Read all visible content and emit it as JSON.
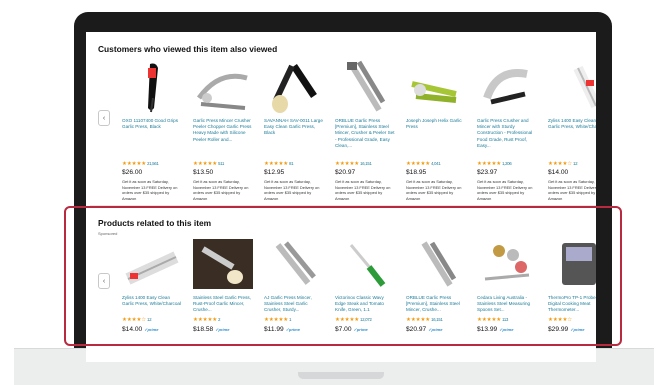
{
  "section1": {
    "title": "Customers who viewed this item also viewed",
    "items": [
      {
        "title": "OXO 11107400 Good Grips Garlic Press, Black",
        "stars": "★★★★★",
        "reviews": "21,561",
        "price": "$26.00",
        "meta": "Get it as soon as Saturday, November 13 FREE Delivery on orders over $35 shipped by Amazon"
      },
      {
        "title": "Garlic Press Mincer Crusher Peeler Chopper Garlic Press Heavy Made with Silicone Peeler Roller and...",
        "stars": "★★★★★",
        "reviews": "511",
        "price": "$13.50",
        "meta": "Get it as soon as Saturday, November 13 FREE Delivery on orders over $35 shipped by Amazon"
      },
      {
        "title": "SAVANNAH SAV-0011 Large Easy Clean Garlic Press, Black",
        "stars": "★★★★★",
        "reviews": "81",
        "price": "$12.95",
        "meta": "Get it as soon as Saturday, November 13 FREE Delivery on orders over $35 shipped by Amazon"
      },
      {
        "title": "ORBLUE Garlic Press [Premium], Stainless Steel Mincer, Crusher & Peeler Set - Professional Grade, Easy Clean,...",
        "stars": "★★★★★",
        "reviews": "16,151",
        "price": "$20.97",
        "meta": "Get it as soon as Saturday, November 13 FREE Delivery on orders over $35 shipped by Amazon"
      },
      {
        "title": "Joseph Joseph Helix Garlic Press",
        "stars": "★★★★★",
        "reviews": "4,041",
        "price": "$18.95",
        "meta": "Get it as soon as Saturday, November 13 FREE Delivery on orders over $35 shipped by Amazon"
      },
      {
        "title": "Garlic Press Crusher and Mincer with Sturdy Construction - Professional Food Grade, Rust Proof, Easy...",
        "stars": "★★★★★",
        "reviews": "1,206",
        "price": "$23.97",
        "meta": "Get it as soon as Saturday, November 13 FREE Delivery on orders over $35 shipped by Amazon"
      },
      {
        "title": "Zyliss 1400 Easy Clean Garlic Press, White/Charcoal",
        "stars": "★★★★☆",
        "reviews": "12",
        "price": "$14.00",
        "meta": "Get it as soon as Saturday, November 13 FREE Delivery on orders over $35 shipped by Amazon"
      }
    ]
  },
  "section2": {
    "title": "Products related to this item",
    "sponsored": "Sponsored",
    "items": [
      {
        "title": "Zyliss 1400 Easy Clean Garlic Press, White/Charcoal",
        "stars": "★★★★☆",
        "reviews": "12",
        "price": "$14.00",
        "prime": "✓prime"
      },
      {
        "title": "Stainless Steel Garlic Press, Rust-Proof Garlic Mincer, Crushe...",
        "stars": "★★★★★",
        "reviews": "2",
        "price": "$18.58",
        "prime": "✓prime"
      },
      {
        "title": "AJ Garlic Press Mincer, Stainless Steel Garlic Crusher, Sturdy...",
        "stars": "★★★★★",
        "reviews": "1",
        "price": "$11.99",
        "prime": "✓prime"
      },
      {
        "title": "Victorinox Classic Wavy Edge Steak and Tomato Knife, Green, 1.1",
        "stars": "★★★★★",
        "reviews": "12,072",
        "price": "$7.00",
        "prime": "✓prime"
      },
      {
        "title": "ORBLUE Garlic Press [Premium], Stainless Steel Mincer, Crushe...",
        "stars": "★★★★★",
        "reviews": "16,151",
        "price": "$20.97",
        "prime": "✓prime"
      },
      {
        "title": "Cedara Living Australia - Stainless Steel Measuring Spoons Set...",
        "stars": "★★★★★",
        "reviews": "113",
        "price": "$13.99",
        "prime": "✓prime"
      },
      {
        "title": "ThermoPro TP-1 Probe Digital Cooking Meat Thermometer...",
        "stars": "★★★★☆",
        "reviews": "",
        "price": "$29.99",
        "prime": "✓prime"
      }
    ]
  },
  "nav": {
    "prev": "‹"
  },
  "colors": {
    "highlight": "#b82a40",
    "link": "#1a7a98",
    "star": "#f39c12"
  }
}
